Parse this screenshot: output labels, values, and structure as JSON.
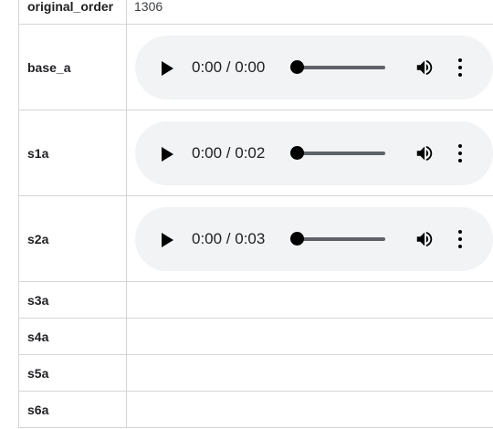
{
  "rows": [
    {
      "key": "original_order",
      "value": "1306"
    },
    {
      "key": "base_a",
      "audio": {
        "time": "0:00 / 0:00",
        "progress": 0
      }
    },
    {
      "key": "s1a",
      "audio": {
        "time": "0:00 / 0:02",
        "progress": 0
      }
    },
    {
      "key": "s2a",
      "audio": {
        "time": "0:00 / 0:03",
        "progress": 0
      }
    },
    {
      "key": "s3a",
      "value": ""
    },
    {
      "key": "s4a",
      "value": ""
    },
    {
      "key": "s5a",
      "value": ""
    },
    {
      "key": "s6a",
      "value": ""
    }
  ],
  "icons": {
    "play": "play-icon",
    "volume": "volume-icon",
    "more": "more-vert-icon"
  }
}
